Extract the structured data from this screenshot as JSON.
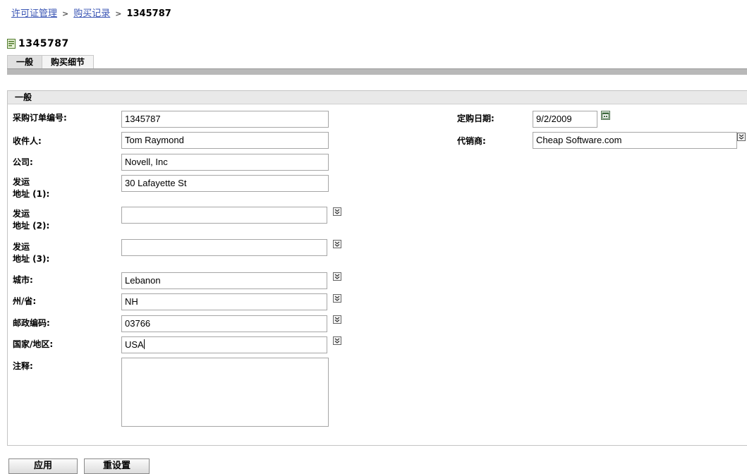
{
  "breadcrumb": {
    "items": [
      "许可证管理",
      "购买记录"
    ],
    "current": "1345787",
    "separator": ">"
  },
  "page": {
    "title": "1345787"
  },
  "tabs": [
    {
      "label": "一般",
      "active": true
    },
    {
      "label": "购买细节",
      "active": false
    }
  ],
  "section": {
    "title": "一般"
  },
  "form": {
    "po_number": {
      "label": "采购订单编号:",
      "value": "1345787"
    },
    "recipient": {
      "label": "收件人:",
      "value": "Tom Raymond"
    },
    "company": {
      "label": "公司:",
      "value": "Novell, Inc"
    },
    "addr1": {
      "label_line1": "发运",
      "label_line2": "地址 (1):",
      "value": "30 Lafayette St"
    },
    "addr2": {
      "label_line1": "发运",
      "label_line2": "地址 (2):",
      "value": ""
    },
    "addr3": {
      "label_line1": "发运",
      "label_line2": "地址 (3):",
      "value": ""
    },
    "city": {
      "label": "城市:",
      "value": "Lebanon"
    },
    "state": {
      "label": "州/省:",
      "value": "NH"
    },
    "zip": {
      "label": "邮政编码:",
      "value": "03766"
    },
    "country": {
      "label": "国家/地区:",
      "value": "USA"
    },
    "notes": {
      "label": "注释:",
      "value": ""
    },
    "purchase_date": {
      "label": "定购日期:",
      "value": "9/2/2009"
    },
    "reseller": {
      "label": "代销商:",
      "value": "Cheap Software.com"
    }
  },
  "buttons": {
    "apply": "应用",
    "reset": "重设置"
  },
  "colors": {
    "link": "#3a55b4",
    "tab_bar": "#b8b8b8",
    "section_header": "#e9e9e9"
  }
}
